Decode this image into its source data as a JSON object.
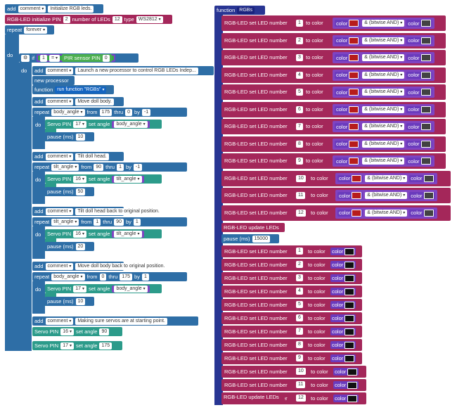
{
  "main": {
    "comment_kw": "add",
    "comment_dd": "comment",
    "comments": [
      "Initialize RGB leds.",
      "Launch a new processor to control RGB LEDs Indep...",
      "Move doll body.",
      "Tilt doll head.",
      "Tilt doll head back to original position.",
      "Move doll body back to original position.",
      "Making sure servos are at starting point."
    ],
    "rgb_init": {
      "label": "RGB-LED initialize PIN",
      "pin": "2",
      "num_label": "number of LEDs",
      "num": "12",
      "type_label": "type",
      "type": "WS2812"
    },
    "repeat": "repeat",
    "forever": "forever",
    "do": "do",
    "if": "if",
    "cond_left": "1",
    "cond_op": "=",
    "pir_label": "PIR sensor PIN",
    "pir_pin": "0",
    "new_processor": "new processor",
    "function_kw": "function",
    "run_function": "run function \"RGBs\"",
    "repeat_kw": "repeat",
    "from": "from",
    "thru": "thru",
    "by": "by",
    "loops": [
      {
        "var": "body_angle",
        "from": "175",
        "thru": "0",
        "by": "-1",
        "servo_pin": "17",
        "pause": "10"
      },
      {
        "var": "tilt_angle",
        "from": "90",
        "thru": "1",
        "by": "-1",
        "servo_pin": "16",
        "pause": "50"
      },
      {
        "var": "tilt_angle",
        "from": "1",
        "thru": "90",
        "by": "1",
        "servo_pin": "16",
        "pause": "20"
      },
      {
        "var": "body_angle",
        "from": "0",
        "thru": "175",
        "by": "1",
        "servo_pin": "17",
        "pause": "10"
      }
    ],
    "servo_label": "Servo PIN",
    "set_angle": "set angle",
    "pause_label": "pause (ms)",
    "final_servos": [
      {
        "pin": "16",
        "angle": "90"
      },
      {
        "pin": "17",
        "angle": "175"
      }
    ]
  },
  "func": {
    "header_kw": "function",
    "name": "RGBs",
    "set_label": "RGB-LED set LED number",
    "to_color": "to color",
    "color_kw": "color",
    "and_label": "& (bitwise AND)",
    "leds": [
      "1",
      "2",
      "3",
      "4",
      "5",
      "6",
      "7",
      "8",
      "9",
      "10",
      "11",
      "12"
    ],
    "update": "RGB-LED update LEDs",
    "pause_label": "pause (ms)",
    "pause": "15000",
    "colors": {
      "red": "#b71c1c",
      "black": "#111111"
    }
  }
}
